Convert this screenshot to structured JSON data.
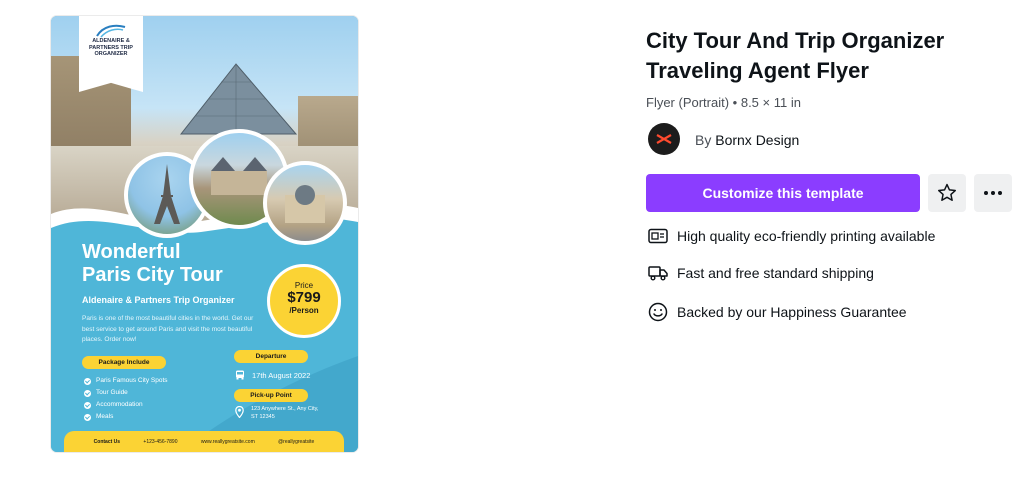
{
  "flyer": {
    "ribbon_text": "ALDENAIRE & PARTNERS TRIP ORGANIZER",
    "title_line1": "Wonderful",
    "title_line2": "Paris City Tour",
    "subtitle": "Aldenaire & Partners Trip Organizer",
    "description": "Paris is one of the most beautiful cities in the world. Get our best service to get around Paris and visit the most beautiful places. Order now!",
    "price_label": "Price",
    "price_value": "$799",
    "price_unit": "/Person",
    "package_heading": "Package Include",
    "package_items": [
      "Paris Famous City Spots",
      "Tour Guide",
      "Accommodation",
      "Meals"
    ],
    "departure_heading": "Departure",
    "departure_date": "17th August 2022",
    "pickup_heading": "Pick-up Point",
    "pickup_address": "123 Anywhere St., Any City, ST 12345",
    "footer": {
      "contact_label": "Contact Us",
      "phone": "+123-456-7890",
      "website": "www.reallygreatsite.com",
      "social": "@reallygreatsite"
    },
    "colors": {
      "background": "#4fb6d8",
      "accent": "#fbd334"
    }
  },
  "template": {
    "title": "City Tour And Trip Organizer Traveling Agent Flyer",
    "meta": "Flyer (Portrait) • 8.5 × 11 in",
    "author_prefix": "By",
    "author_name": "Bornx Design",
    "customize_label": "Customize this template",
    "star_icon": "star-icon",
    "more_icon": "more-horizontal-icon",
    "accent_color": "#8b3dff"
  },
  "features": [
    {
      "icon": "printing-icon",
      "label": "High quality eco-friendly printing available"
    },
    {
      "icon": "truck-icon",
      "label": "Fast and free standard shipping"
    },
    {
      "icon": "smile-icon",
      "label": "Backed by our Happiness Guarantee"
    }
  ]
}
